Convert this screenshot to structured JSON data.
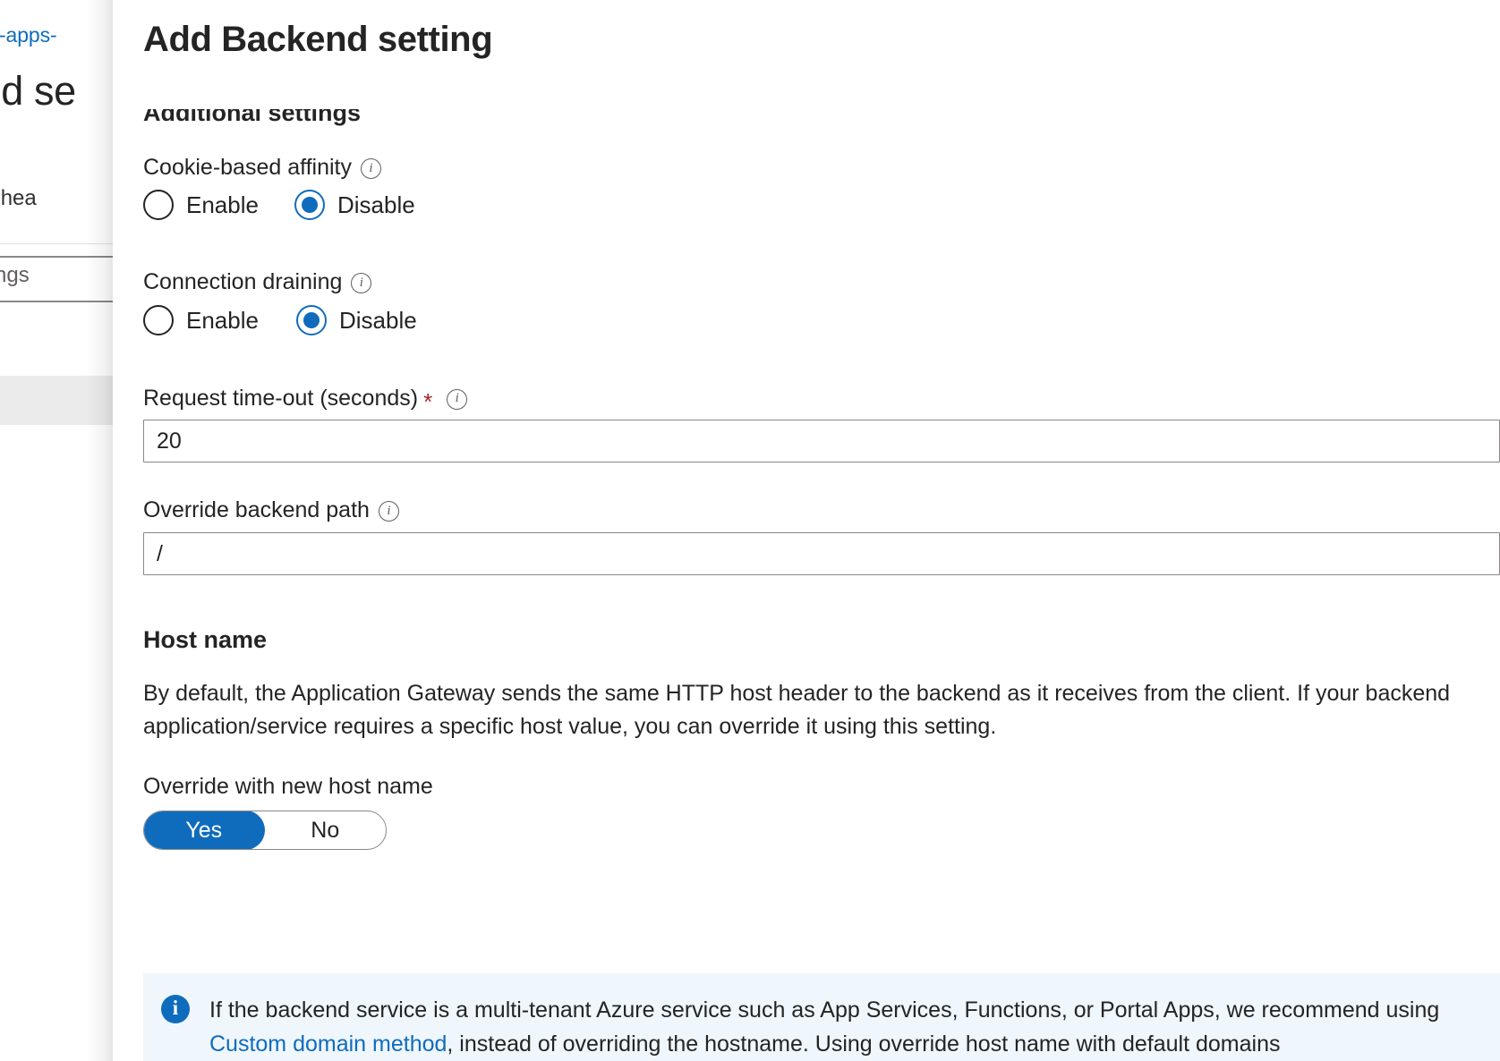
{
  "background_blade": {
    "breadcrumb_link": "ner-apps-",
    "page_title": "end se",
    "nav_item": "ckend hea",
    "tab_label": "d settings"
  },
  "panel": {
    "title": "Add Backend setting",
    "additional_settings_heading": "Additional settings",
    "cookie_affinity": {
      "label": "Cookie-based affinity",
      "info_icon": "info-icon",
      "options": [
        "Enable",
        "Disable"
      ],
      "selected": "Disable"
    },
    "connection_draining": {
      "label": "Connection draining",
      "info_icon": "info-icon",
      "options": [
        "Enable",
        "Disable"
      ],
      "selected": "Disable"
    },
    "request_timeout": {
      "label": "Request time-out (seconds)",
      "required_marker": "*",
      "info_icon": "info-icon",
      "value": "20"
    },
    "override_backend_path": {
      "label": "Override backend path",
      "info_icon": "info-icon",
      "value": "/"
    },
    "host_name": {
      "heading": "Host name",
      "description": "By default, the Application Gateway sends the same HTTP host header to the backend as it receives from the client. If your backend application/service requires a specific host value, you can override it using this setting.",
      "toggle_label": "Override with new host name",
      "toggle_options": [
        "Yes",
        "No"
      ],
      "toggle_selected": "Yes"
    },
    "info_banner": {
      "icon": "info-filled-icon",
      "text_before_link": "If the backend service is a multi-tenant Azure service such as App Services, Functions, or Portal Apps, we recommend using ",
      "link_text": "Custom domain method",
      "text_after_link": ", instead of overriding the hostname. Using override host name with default domains"
    }
  },
  "colors": {
    "accent": "#0f6cbd",
    "required": "#a4262c",
    "banner_bg": "#eff6fc",
    "text": "#242424",
    "border": "#8a8886"
  }
}
